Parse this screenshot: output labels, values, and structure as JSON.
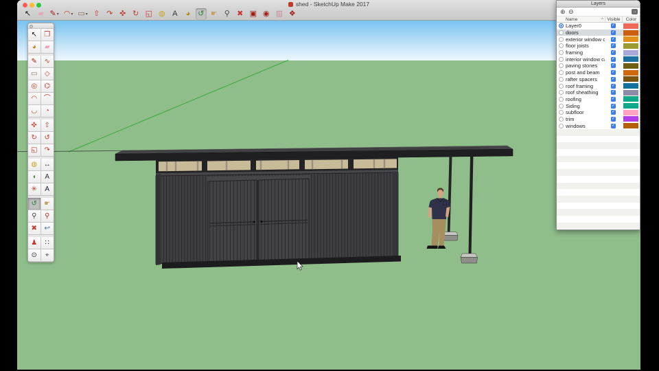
{
  "colors": {
    "desktop": "#000000",
    "ground": "#8FBE8A",
    "sky_top": "#79C3F1",
    "sky_mid": "#C7E5F8",
    "sky_bottom": "#EDF6FD",
    "axis_green": "#3AA83C",
    "wall": "#3F3F42",
    "wall_line": "#2B2B2E",
    "door": "#434347",
    "door_line": "#2D2D31",
    "roof_top": "#454547",
    "roof_fascia": "#1F1F21",
    "glass": "#C8BB98",
    "base": "#1C1C1E",
    "shirt": "#2F3248",
    "skin": "#D7A183",
    "pants": "#A78E5F",
    "accent_blue": "#3D7EE8",
    "selection_row": "#D8DBDF"
  },
  "window": {
    "title": "shed - SketchUp Make 2017",
    "traffic_lights": [
      "#FF5F57",
      "#FEBC2E",
      "#28C840"
    ]
  },
  "toolbar": {
    "items": [
      {
        "name": "select",
        "glyph": "↖",
        "color": "#141414",
        "dropdown": false,
        "active": false
      },
      {
        "name": "eraser",
        "glyph": "▰",
        "color": "#E8A7B8",
        "dropdown": false,
        "active": false
      },
      {
        "name": "line",
        "glyph": "✎",
        "color": "#A32014",
        "dropdown": true,
        "active": false
      },
      {
        "name": "arc",
        "glyph": "◠",
        "color": "#C23B2E",
        "dropdown": true,
        "active": false
      },
      {
        "name": "rectangle",
        "glyph": "▭",
        "color": "#8A6F5E",
        "dropdown": true,
        "active": false
      },
      {
        "name": "push-pull",
        "glyph": "⇧",
        "color": "#C23B2E",
        "dropdown": false,
        "active": false
      },
      {
        "name": "offset",
        "glyph": "↷",
        "color": "#C23B2E",
        "dropdown": false,
        "active": false
      },
      {
        "name": "move",
        "glyph": "✜",
        "color": "#C23B2E",
        "dropdown": false,
        "active": false
      },
      {
        "name": "rotate",
        "glyph": "↻",
        "color": "#C23B2E",
        "dropdown": false,
        "active": false
      },
      {
        "name": "scale",
        "glyph": "◱",
        "color": "#C23B2E",
        "dropdown": false,
        "active": false
      },
      {
        "name": "tape-measure",
        "glyph": "◍",
        "color": "#C9A227",
        "dropdown": false,
        "active": false
      },
      {
        "name": "text",
        "glyph": "A",
        "color": "#333333",
        "dropdown": false,
        "active": false
      },
      {
        "name": "paint-bucket",
        "glyph": "◕",
        "color": "#B8860B",
        "dropdown": false,
        "active": false
      },
      {
        "name": "orbit",
        "glyph": "↺",
        "color": "#2E7D32",
        "dropdown": false,
        "active": true
      },
      {
        "name": "pan",
        "glyph": "☛",
        "color": "#C89F6B",
        "dropdown": false,
        "active": false
      },
      {
        "name": "zoom",
        "glyph": "⚲",
        "color": "#444444",
        "dropdown": false,
        "active": false
      },
      {
        "name": "zoom-extents",
        "glyph": "✖",
        "color": "#C23B2E",
        "dropdown": false,
        "active": false
      },
      {
        "name": "3d-warehouse",
        "glyph": "▣",
        "color": "#A32014",
        "dropdown": false,
        "active": false
      },
      {
        "name": "share-model",
        "glyph": "◉",
        "color": "#A32014",
        "dropdown": false,
        "active": false
      },
      {
        "name": "send-to-layout",
        "glyph": "▥",
        "color": "#C98C9A",
        "dropdown": false,
        "active": false
      },
      {
        "name": "extension-warehouse",
        "glyph": "❖",
        "color": "#A32014",
        "dropdown": false,
        "active": false
      }
    ]
  },
  "tool_palette": {
    "rows": [
      [
        {
          "name": "select",
          "glyph": "↖",
          "color": "#141414"
        },
        {
          "name": "make-component",
          "glyph": "❒",
          "color": "#C23B2E"
        }
      ],
      [
        {
          "name": "paint-bucket",
          "glyph": "◕",
          "color": "#B8860B"
        },
        {
          "name": "eraser",
          "glyph": "▰",
          "color": "#E8A7B8"
        }
      ],
      [
        {
          "name": "line",
          "glyph": "✎",
          "color": "#A32014"
        },
        {
          "name": "freehand",
          "glyph": "∿",
          "color": "#C23B2E"
        }
      ],
      [
        {
          "name": "rectangle",
          "glyph": "▭",
          "color": "#8A6F5E"
        },
        {
          "name": "rotated-rectangle",
          "glyph": "◇",
          "color": "#C23B2E"
        }
      ],
      [
        {
          "name": "circle",
          "glyph": "◎",
          "color": "#C23B2E"
        },
        {
          "name": "polygon",
          "glyph": "⌬",
          "color": "#C23B2E"
        }
      ],
      [
        {
          "name": "arc",
          "glyph": "◠",
          "color": "#C23B2E"
        },
        {
          "name": "two-point-arc",
          "glyph": "⌒",
          "color": "#C23B2E"
        }
      ],
      [
        {
          "name": "three-point-arc",
          "glyph": "◡",
          "color": "#C23B2E"
        },
        {
          "name": "pie",
          "glyph": "◔",
          "color": "#C23B2E"
        }
      ],
      [
        {
          "name": "move",
          "glyph": "✜",
          "color": "#C23B2E"
        },
        {
          "name": "push-pull",
          "glyph": "⇧",
          "color": "#C23B2E"
        }
      ],
      [
        {
          "name": "rotate",
          "glyph": "↻",
          "color": "#C23B2E"
        },
        {
          "name": "follow-me",
          "glyph": "↺",
          "color": "#C23B2E"
        }
      ],
      [
        {
          "name": "scale",
          "glyph": "◱",
          "color": "#C23B2E"
        },
        {
          "name": "offset",
          "glyph": "↷",
          "color": "#C23B2E"
        }
      ],
      [
        {
          "name": "tape-measure",
          "glyph": "◍",
          "color": "#C9A227"
        },
        {
          "name": "dimension",
          "glyph": "↔",
          "color": "#333333"
        }
      ],
      [
        {
          "name": "protractor",
          "glyph": "◖",
          "color": "#4C8A3F"
        },
        {
          "name": "text",
          "glyph": "A",
          "color": "#333333"
        }
      ],
      [
        {
          "name": "axes",
          "glyph": "✳",
          "color": "#C23B2E"
        },
        {
          "name": "3d-text",
          "glyph": "A",
          "color": "#1A1A3A"
        }
      ],
      [
        {
          "name": "orbit",
          "glyph": "↺",
          "color": "#2E7D32",
          "active": true
        },
        {
          "name": "pan",
          "glyph": "☛",
          "color": "#C89F6B"
        }
      ],
      [
        {
          "name": "zoom",
          "glyph": "⚲",
          "color": "#444444"
        },
        {
          "name": "zoom-window",
          "glyph": "⚲",
          "color": "#C23B2E"
        }
      ],
      [
        {
          "name": "zoom-extents",
          "glyph": "✖",
          "color": "#C23B2E"
        },
        {
          "name": "zoom-previous",
          "glyph": "↩",
          "color": "#3A6EA5"
        }
      ],
      [
        {
          "name": "position-camera",
          "glyph": "♟",
          "color": "#C23B2E"
        },
        {
          "name": "walk",
          "glyph": "∷",
          "color": "#222222"
        }
      ],
      [
        {
          "name": "look-around",
          "glyph": "⊙",
          "color": "#333333"
        },
        {
          "name": "section-plane",
          "glyph": "⌖",
          "color": "#555555"
        }
      ]
    ]
  },
  "layers_panel": {
    "title": "Layers",
    "add_button": "⊕",
    "remove_button": "⊖",
    "detach_button": "→",
    "columns": {
      "name": "Name",
      "sort_indicator": "^",
      "visible": "Visible",
      "color": "Color"
    },
    "layers": [
      {
        "name": "Layer0",
        "radio_selected": true,
        "row_selected": false,
        "visible": true,
        "color": "#F0685C"
      },
      {
        "name": "doors",
        "radio_selected": false,
        "row_selected": true,
        "visible": true,
        "color": "#CC5E10"
      },
      {
        "name": "exterior window ca",
        "radio_selected": false,
        "row_selected": false,
        "visible": true,
        "color": "#E2921C"
      },
      {
        "name": "floor joists",
        "radio_selected": false,
        "row_selected": false,
        "visible": true,
        "color": "#9B9B30"
      },
      {
        "name": "framing",
        "radio_selected": false,
        "row_selected": false,
        "visible": true,
        "color": "#A9A9D9"
      },
      {
        "name": "interior window ca",
        "radio_selected": false,
        "row_selected": false,
        "visible": true,
        "color": "#1C6F9F"
      },
      {
        "name": "paving stones",
        "radio_selected": false,
        "row_selected": false,
        "visible": true,
        "color": "#6E5D12"
      },
      {
        "name": "post and beam",
        "radio_selected": false,
        "row_selected": false,
        "visible": true,
        "color": "#D06A10"
      },
      {
        "name": "rafter spacers",
        "radio_selected": false,
        "row_selected": false,
        "visible": true,
        "color": "#7A5410"
      },
      {
        "name": "roof framing",
        "radio_selected": false,
        "row_selected": false,
        "visible": true,
        "color": "#15719E"
      },
      {
        "name": "roof sheathing",
        "radio_selected": false,
        "row_selected": false,
        "visible": true,
        "color": "#8C8CA9"
      },
      {
        "name": "roofing",
        "radio_selected": false,
        "row_selected": false,
        "visible": true,
        "color": "#10A98B"
      },
      {
        "name": "Siding",
        "radio_selected": false,
        "row_selected": false,
        "visible": true,
        "color": "#10A98B"
      },
      {
        "name": "subfloor",
        "radio_selected": false,
        "row_selected": false,
        "visible": true,
        "color": "#FFA3C2"
      },
      {
        "name": "trim",
        "radio_selected": false,
        "row_selected": false,
        "visible": true,
        "color": "#B23FE6"
      },
      {
        "name": "windows",
        "radio_selected": false,
        "row_selected": false,
        "visible": true,
        "color": "#B55F08"
      }
    ],
    "empty_rows": 15,
    "checkmark": "✓"
  }
}
